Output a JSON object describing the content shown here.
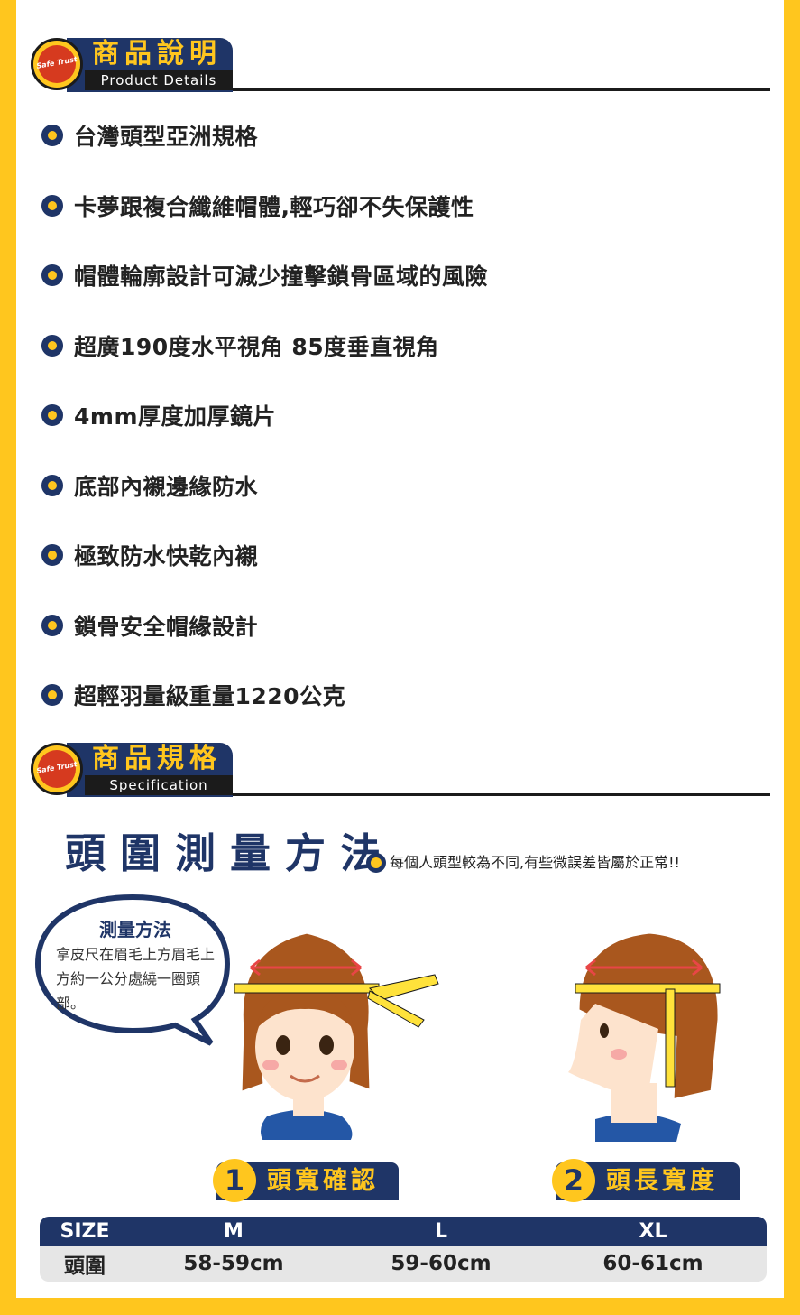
{
  "section_details": {
    "title_zh": "商品說明",
    "title_en": "Product Details",
    "logo_text": "Safe Trust"
  },
  "features": [
    "台灣頭型亞洲規格",
    "卡夢跟複合纖維帽體,輕巧卻不失保護性",
    "帽體輪廓設計可減少撞擊鎖骨區域的風險",
    "超廣190度水平視角 85度垂直視角",
    "4mm厚度加厚鏡片",
    "底部內襯邊緣防水",
    "極致防水快乾內襯",
    "鎖骨安全帽緣設計",
    "超輕羽量級重量1220公克"
  ],
  "section_spec": {
    "title_zh": "商品規格",
    "title_en": "Specification",
    "logo_text": "Safe Trust"
  },
  "measure": {
    "title": "頭圍測量方法",
    "note": "每個人頭型較為不同,有些微誤差皆屬於正常!!",
    "bubble_title": "測量方法",
    "bubble_body": "拿皮尺在眉毛上方眉毛上方約一公分處繞一圈頭部。",
    "step1_num": "1",
    "step1_label": "頭寬確認",
    "step2_num": "2",
    "step2_label": "頭長寬度"
  },
  "size_table": {
    "header": [
      "SIZE",
      "M",
      "L",
      "XL"
    ],
    "row": [
      "頭圍",
      "58-59cm",
      "59-60cm",
      "60-61cm"
    ]
  },
  "colors": {
    "navy": "#1f3567",
    "yellow": "#ffc61e",
    "hair": "#a9571e",
    "skin": "#fde3cd"
  }
}
